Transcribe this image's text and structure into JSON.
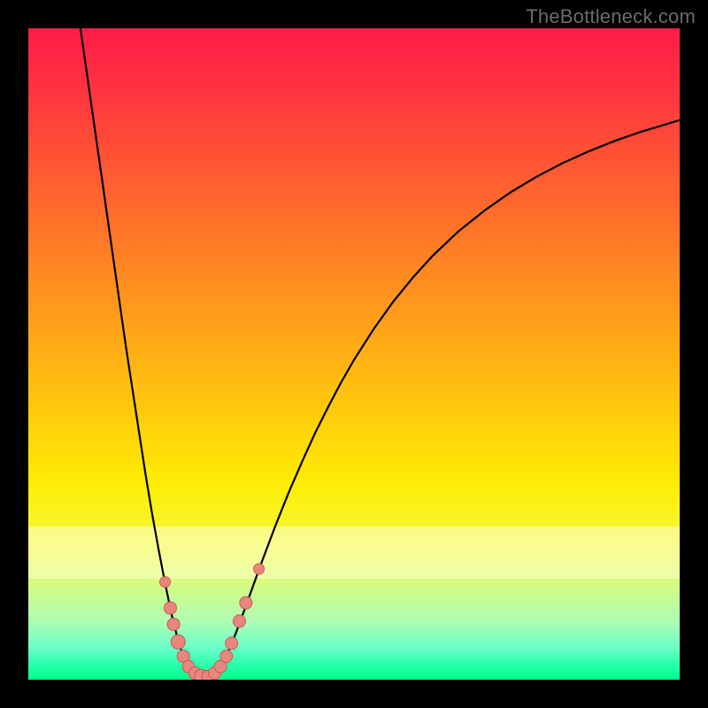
{
  "watermark": "TheBottleneck.com",
  "colors": {
    "background_frame": "#000000",
    "curve": "#000000",
    "dot_fill": "#e9867e",
    "dot_stroke": "#c95a52"
  },
  "chart_data": {
    "type": "line",
    "title": "",
    "xlabel": "",
    "ylabel": "",
    "xlim": [
      0,
      100
    ],
    "ylim": [
      0,
      100
    ],
    "grid": false,
    "curve_points_xy": [
      [
        8,
        100
      ],
      [
        9,
        93
      ],
      [
        10,
        86
      ],
      [
        11,
        79
      ],
      [
        12,
        72
      ],
      [
        13,
        65
      ],
      [
        14,
        58
      ],
      [
        15,
        51
      ],
      [
        16,
        44.5
      ],
      [
        17,
        38
      ],
      [
        18,
        31.5
      ],
      [
        19,
        25.5
      ],
      [
        20,
        20
      ],
      [
        21,
        14.8
      ],
      [
        22,
        10
      ],
      [
        23,
        6
      ],
      [
        24,
        3
      ],
      [
        25,
        1.2
      ],
      [
        26,
        0.4
      ],
      [
        27,
        0.1
      ],
      [
        28,
        0.4
      ],
      [
        29,
        1.2
      ],
      [
        30,
        2.8
      ],
      [
        31,
        5
      ],
      [
        32,
        7.5
      ],
      [
        33,
        10.2
      ],
      [
        34,
        13
      ],
      [
        36,
        18.5
      ],
      [
        38,
        23.8
      ],
      [
        40,
        28.8
      ],
      [
        42,
        33.4
      ],
      [
        44,
        37.8
      ],
      [
        46,
        41.8
      ],
      [
        48,
        45.6
      ],
      [
        50,
        49.1
      ],
      [
        53,
        53.8
      ],
      [
        56,
        58
      ],
      [
        59,
        61.7
      ],
      [
        62,
        65
      ],
      [
        66,
        68.8
      ],
      [
        70,
        72
      ],
      [
        74,
        74.8
      ],
      [
        78,
        77.2
      ],
      [
        82,
        79.3
      ],
      [
        86,
        81.1
      ],
      [
        90,
        82.7
      ],
      [
        94,
        84.1
      ],
      [
        98,
        85.3
      ],
      [
        100,
        85.9
      ]
    ],
    "dots_xy_r": [
      [
        21.0,
        15.0,
        6
      ],
      [
        21.8,
        11.0,
        7
      ],
      [
        22.3,
        8.5,
        7
      ],
      [
        23.0,
        5.8,
        8
      ],
      [
        23.8,
        3.6,
        7
      ],
      [
        24.6,
        2.0,
        7
      ],
      [
        25.6,
        1.0,
        7
      ],
      [
        26.6,
        0.5,
        8
      ],
      [
        27.6,
        0.5,
        7
      ],
      [
        28.6,
        1.0,
        7
      ],
      [
        29.5,
        2.0,
        7
      ],
      [
        30.4,
        3.6,
        7
      ],
      [
        31.2,
        5.6,
        7
      ],
      [
        32.4,
        9.0,
        7
      ],
      [
        33.4,
        11.8,
        7
      ],
      [
        35.4,
        17.0,
        6
      ]
    ],
    "minimum_x_approx": 27
  }
}
